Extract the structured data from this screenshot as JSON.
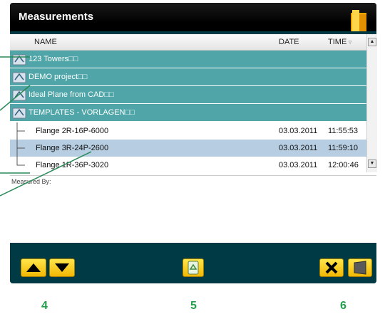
{
  "window": {
    "title": "Measurements"
  },
  "columns": {
    "name": "NAME",
    "date": "DATE",
    "time": "TIME"
  },
  "groups": [
    {
      "name": "123 Towers□□"
    },
    {
      "name": "DEMO project□□"
    },
    {
      "name": "Ideal Plane from CAD□□"
    },
    {
      "name": "TEMPLATES - VORLAGEN□□"
    }
  ],
  "items": [
    {
      "name": "Flange 2R-16P-6000",
      "date": "03.03.2011",
      "time": "11:55:53"
    },
    {
      "name": "Flange 3R-24P-2600",
      "date": "03.03.2011",
      "time": "11:59:10"
    },
    {
      "name": "Flange 1R-36P-3020",
      "date": "03.03.2011",
      "time": "12:00:46"
    }
  ],
  "measured_by": {
    "label": "Measured By:",
    "value": ""
  },
  "callouts": [
    "4",
    "5",
    "6"
  ],
  "colors": {
    "accent": "#20a04a",
    "group_row": "#4fa5a7",
    "panel": "#003a45",
    "button": "#f2c20a"
  },
  "icons": [
    "folder-icon",
    "group-folder-icon",
    "up-arrow-icon",
    "down-arrow-icon",
    "recycle-icon",
    "close-icon",
    "exit-icon"
  ]
}
